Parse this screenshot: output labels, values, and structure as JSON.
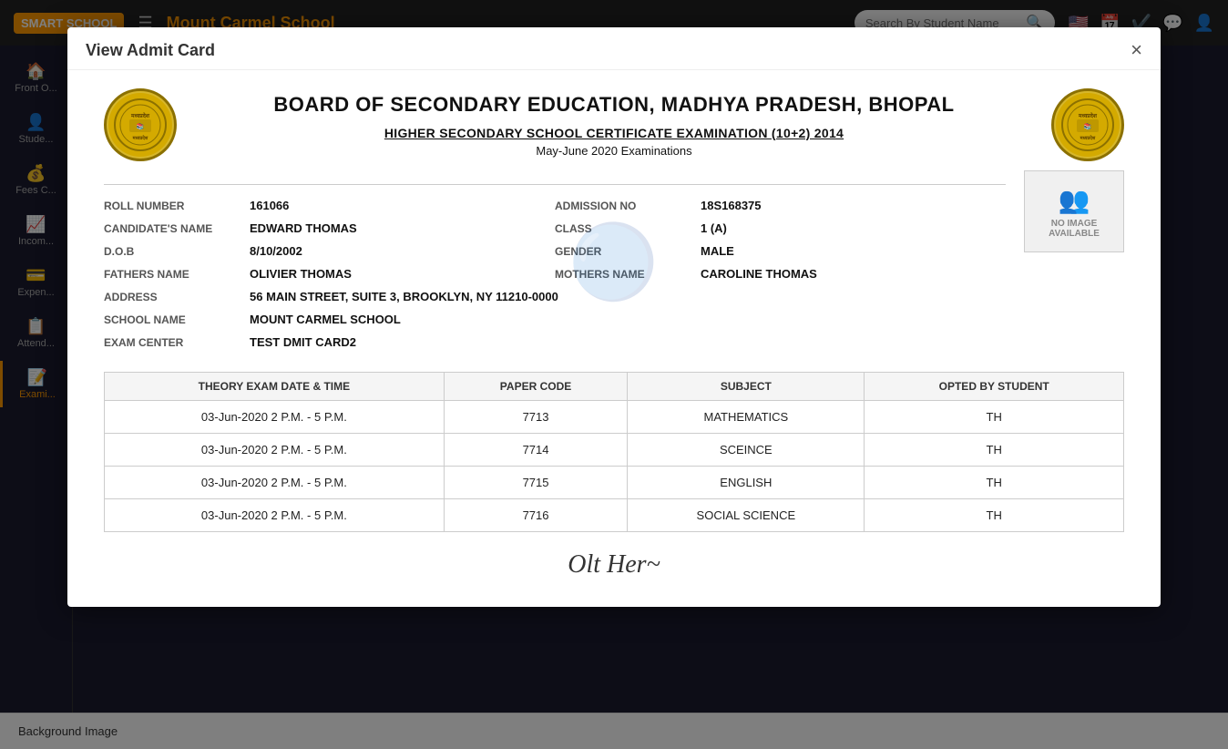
{
  "app": {
    "name": "SMART SCHOOL",
    "school_name": "Mount Carmel School"
  },
  "navbar": {
    "search_placeholder": "Search By Student Name",
    "icons": [
      "calendar",
      "check",
      "whatsapp",
      "user"
    ]
  },
  "sidebar": {
    "items": [
      {
        "label": "Front O...",
        "icon": "🏠"
      },
      {
        "label": "Stude...",
        "icon": "👤"
      },
      {
        "label": "Fees C...",
        "icon": "💰"
      },
      {
        "label": "Incom...",
        "icon": "📈"
      },
      {
        "label": "Expen...",
        "icon": "💳"
      },
      {
        "label": "Attend...",
        "icon": "📋"
      },
      {
        "label": "Exami...",
        "icon": "📝",
        "active": true
      }
    ]
  },
  "modal": {
    "title": "View Admit Card",
    "close_label": "×"
  },
  "admit_card": {
    "board_title": "BOARD OF SECONDARY EDUCATION, MADHYA PRADESH, BHOPAL",
    "exam_title": "HIGHER SECONDARY SCHOOL CERTIFICATE EXAMINATION (10+2) 2014",
    "exam_period": "May-June 2020 Examinations",
    "roll_number_label": "ROLL NUMBER",
    "roll_number": "161066",
    "admission_no_label": "ADMISSION NO",
    "admission_no": "18S168375",
    "candidate_name_label": "CANDIDATE'S NAME",
    "candidate_name": "EDWARD THOMAS",
    "class_label": "CLASS",
    "class_value": "1 (A)",
    "dob_label": "D.O.B",
    "dob": "8/10/2002",
    "gender_label": "GENDER",
    "gender": "MALE",
    "fathers_name_label": "FATHERS NAME",
    "fathers_name": "OLIVIER THOMAS",
    "mothers_name_label": "MOTHERS NAME",
    "mothers_name": "CAROLINE THOMAS",
    "address_label": "ADDRESS",
    "address": "56 MAIN STREET, SUITE 3, BROOKLYN, NY 11210-0000",
    "school_name_label": "SCHOOL NAME",
    "school_name": "MOUNT CARMEL SCHOOL",
    "exam_center_label": "EXAM CENTER",
    "exam_center": "TEST DMIT CARD2",
    "photo_placeholder": "NO IMAGE\nAVAILABLE",
    "table": {
      "headers": [
        "THEORY EXAM DATE & TIME",
        "PAPER CODE",
        "SUBJECT",
        "OPTED BY STUDENT"
      ],
      "rows": [
        {
          "date": "03-Jun-2020 2 P.M. - 5 P.M.",
          "paper_code": "7713",
          "subject": "MATHEMATICS",
          "opted": "TH"
        },
        {
          "date": "03-Jun-2020 2 P.M. - 5 P.M.",
          "paper_code": "7714",
          "subject": "SCEINCE",
          "opted": "TH"
        },
        {
          "date": "03-Jun-2020 2 P.M. - 5 P.M.",
          "paper_code": "7715",
          "subject": "ENGLISH",
          "opted": "TH"
        },
        {
          "date": "03-Jun-2020 2 P.M. - 5 P.M.",
          "paper_code": "7716",
          "subject": "SOCIAL SCIENCE",
          "opted": "TH"
        }
      ]
    }
  },
  "bottom_bar": {
    "label": "Background Image"
  }
}
